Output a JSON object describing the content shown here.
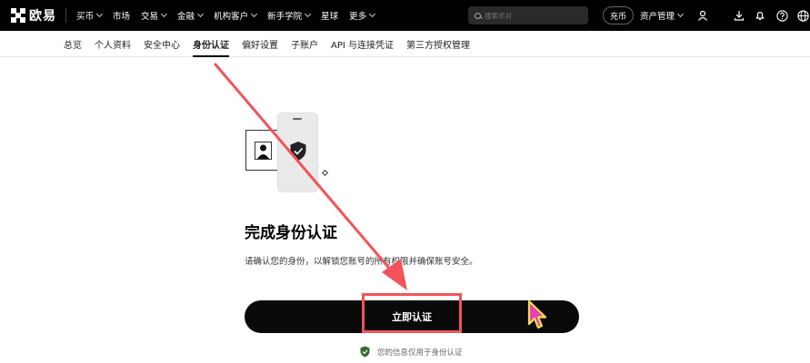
{
  "topbar": {
    "logo_text": "欧易",
    "nav": [
      {
        "label": "买币",
        "caret": true
      },
      {
        "label": "市场",
        "caret": false
      },
      {
        "label": "交易",
        "caret": true
      },
      {
        "label": "金融",
        "caret": true
      },
      {
        "label": "机构客户",
        "caret": true
      },
      {
        "label": "新手学院",
        "caret": true
      },
      {
        "label": "星球",
        "caret": false
      },
      {
        "label": "更多",
        "caret": true
      }
    ],
    "search_placeholder": "搜索币对",
    "deposit_label": "充币",
    "assets_label": "资产管理",
    "icons": [
      "user-icon",
      "download-icon",
      "bell-icon",
      "help-icon",
      "globe-icon"
    ]
  },
  "subnav": {
    "items": [
      "总览",
      "个人资料",
      "安全中心",
      "身份认证",
      "偏好设置",
      "子账户",
      "API 与连接凭证",
      "第三方授权管理"
    ],
    "active_index": 3
  },
  "main": {
    "title": "完成身份认证",
    "description": "请确认您的身份，以解锁您账号的所有权限并确保账号安全。",
    "verify_button": "立即认证",
    "privacy_note": "您的信息仅用于身份认证"
  },
  "colors": {
    "annotation_red": "#f2545b",
    "cursor_magenta": "#e83fb4",
    "cursor_yellow": "#f7e04a",
    "shield_green": "#2f6b2f"
  }
}
